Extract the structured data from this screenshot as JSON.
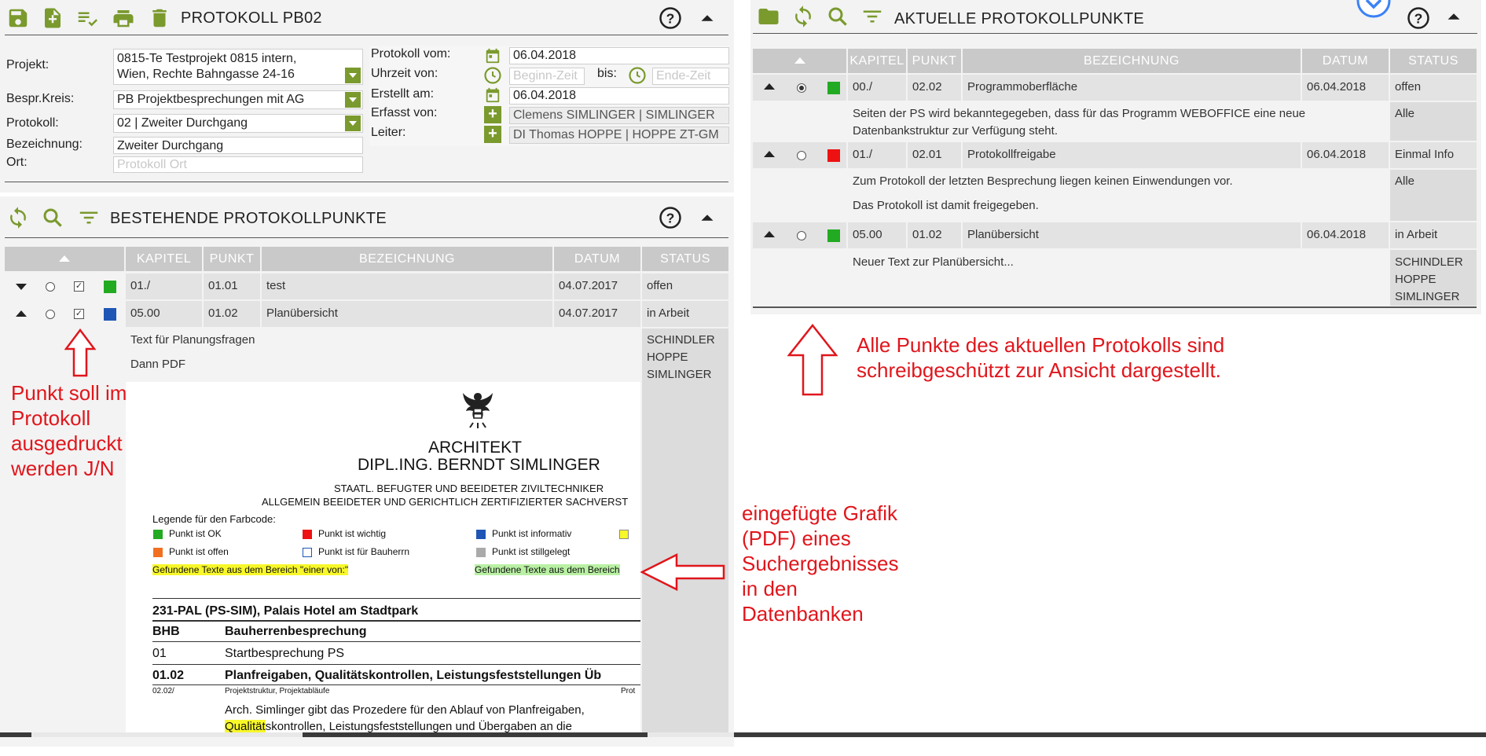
{
  "left_panel": {
    "title": "PROTOKOLL PB02",
    "form": {
      "projekt_label": "Projekt:",
      "projekt_line1": "0815-Te Testprojekt 0815 intern,",
      "projekt_line2": "Wien, Rechte Bahngasse 24-16",
      "kreis_label": "Bespr.Kreis:",
      "kreis_value": "PB Projektbesprechungen mit AG",
      "protokoll_label": "Protokoll:",
      "protokoll_value": "02 | Zweiter Durchgang",
      "bezeichnung_label": "Bezeichnung:",
      "bezeichnung_value": "Zweiter Durchgang",
      "ort_label": "Ort:",
      "ort_placeholder": "Protokoll Ort",
      "vom_label": "Protokoll vom:",
      "vom_value": "06.04.2018",
      "uhrzeit_label": "Uhrzeit von:",
      "beginn_placeholder": "Beginn-Zeit",
      "bis_label": "bis:",
      "ende_placeholder": "Ende-Zeit",
      "erstellt_label": "Erstellt am:",
      "erstellt_value": "06.04.2018",
      "erfasst_label": "Erfasst von:",
      "erfasst_value": "Clemens SIMLINGER | SIMLINGER",
      "leiter_label": "Leiter:",
      "leiter_value": "DI Thomas HOPPE | HOPPE ZT-GM"
    }
  },
  "bestehende": {
    "title": "BESTEHENDE PROTOKOLLPUNKTE",
    "columns": [
      "KAPITEL",
      "PUNKT",
      "BEZEICHNUNG",
      "DATUM",
      "STATUS"
    ],
    "rows": [
      {
        "kapitel": "01./",
        "punkt": "01.01",
        "bezeichnung": "test",
        "datum": "04.07.2017",
        "status": "offen",
        "color": "#22aa22"
      },
      {
        "kapitel": "05.00",
        "punkt": "01.02",
        "bezeichnung": "Planübersicht",
        "datum": "04.07.2017",
        "status": "in Arbeit",
        "color": "#1f56b5"
      }
    ],
    "detail_text1": "Text für Planungsfragen",
    "detail_text2": "Dann PDF",
    "detail_status": [
      "SCHINDLER",
      "HOPPE",
      "SIMLINGER"
    ]
  },
  "pdf": {
    "title1": "ARCHITEKT",
    "title2": "DIPL.ING. BERNDT SIMLINGER",
    "sub1": "STAATL. BEFUGTER UND BEEIDETER ZIVILTECHNIKER",
    "sub2": "ALLGEMEIN BEEIDETER UND GERICHTLICH ZERTIFIZIERTER SACHVERST",
    "legend_title": "Legende für den Farbcode:",
    "legend": [
      {
        "label": "Punkt ist OK",
        "color": "#22aa22"
      },
      {
        "label": "Punkt ist wichtig",
        "color": "#ee1111"
      },
      {
        "label": "Punkt ist informativ",
        "color": "#1f56b5"
      },
      {
        "label": "Punkt ist offen",
        "color": "#f07020"
      },
      {
        "label": "Punkt ist für Bauherrn",
        "color": "#ffffff"
      },
      {
        "label": "Punkt ist stillgelegt",
        "color": "#aaaaaa"
      }
    ],
    "hl1": "Gefundene Texte aus dem Bereich \"einer von:\"",
    "hl2": "Gefundene Texte aus dem Bereich",
    "section": "231-PAL (PS-SIM), Palais Hotel am Stadtpark",
    "r1_code": "BHB",
    "r1_text": "Bauherrenbesprechung",
    "r2_code": "01",
    "r2_text": "Startbesprechung PS",
    "r3_code": "01.02",
    "r3_text": "Planfreigaben, Qualitätskontrollen, Leistungsfeststellungen Üb",
    "small_code": "02.02/",
    "small_text": "Projektstruktur, Projektabläufe",
    "small_right": "Prot",
    "body1": "Arch. Simlinger gibt das Prozedere für den Ablauf von Planfreigaben,",
    "body2_hl": "Qualität",
    "body2_rest": "skontrollen, Leistungsfeststellungen und Übergaben an die"
  },
  "aktuelle": {
    "title": "AKTUELLE PROTOKOLLPUNKTE",
    "columns": [
      "KAPITEL",
      "PUNKT",
      "BEZEICHNUNG",
      "DATUM",
      "STATUS"
    ],
    "rows": [
      {
        "kapitel": "00./",
        "punkt": "02.02",
        "bezeichnung": "Programmoberfläche",
        "datum": "06.04.2018",
        "status": "offen",
        "color": "#22aa22",
        "detail1": "Seiten der PS wird bekanntegegeben, dass für das Programm WEBOFFICE eine neue",
        "detail2": "Datenbankstruktur zur Verfügung steht.",
        "detail_status": "Alle"
      },
      {
        "kapitel": "01./",
        "punkt": "02.01",
        "bezeichnung": "Protokollfreigabe",
        "datum": "06.04.2018",
        "status": "Einmal Info",
        "color": "#ee1111",
        "detail1": "Zum Protokoll der letzten Besprechung liegen keinen Einwendungen vor.",
        "detail2": "Das Protokoll ist damit freigegeben.",
        "detail_status": "Alle"
      },
      {
        "kapitel": "05.00",
        "punkt": "01.02",
        "bezeichnung": "Planübersicht",
        "datum": "06.04.2018",
        "status": "in Arbeit",
        "color": "#22aa22",
        "detail1": "Neuer Text zur Planübersicht...",
        "detail_status": [
          "SCHINDLER",
          "HOPPE",
          "SIMLINGER"
        ]
      }
    ]
  },
  "annotations": {
    "left": [
      "Punkt soll im",
      "Protokoll",
      "ausgedruckt",
      "werden J/N"
    ],
    "middle": [
      "eingefügte Grafik",
      "(PDF) eines",
      "Suchergebnisses",
      "in den",
      "Datenbanken"
    ],
    "right": [
      "Alle Punkte des aktuellen Protokolls sind",
      "schreibgeschützt zur Ansicht dargestellt."
    ]
  },
  "colors": {
    "accent": "#7a9a2e",
    "header_bg": "#c9c9c9",
    "row_bg": "#e3e3e3",
    "annotation": "#e0161c"
  },
  "icons": [
    "save-icon",
    "add-document-icon",
    "checklist-icon",
    "print-icon",
    "delete-icon",
    "help-icon",
    "collapse-icon",
    "refresh-icon",
    "search-icon",
    "filter-icon",
    "calendar-icon",
    "clock-icon"
  ]
}
